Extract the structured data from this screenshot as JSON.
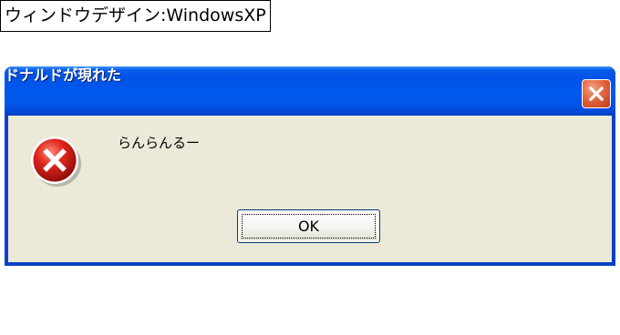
{
  "caption": "ウィンドウデザイン:WindowsXP",
  "dialog": {
    "title": "ドナルドが現れた",
    "message": "らんらんるー",
    "ok_label": "OK",
    "close_icon": "close-icon",
    "status_icon": "error-icon"
  },
  "colors": {
    "titlebar": "#0055e5",
    "client": "#ece9d8",
    "close_button": "#e1673f",
    "error_icon": "#d0241c"
  }
}
